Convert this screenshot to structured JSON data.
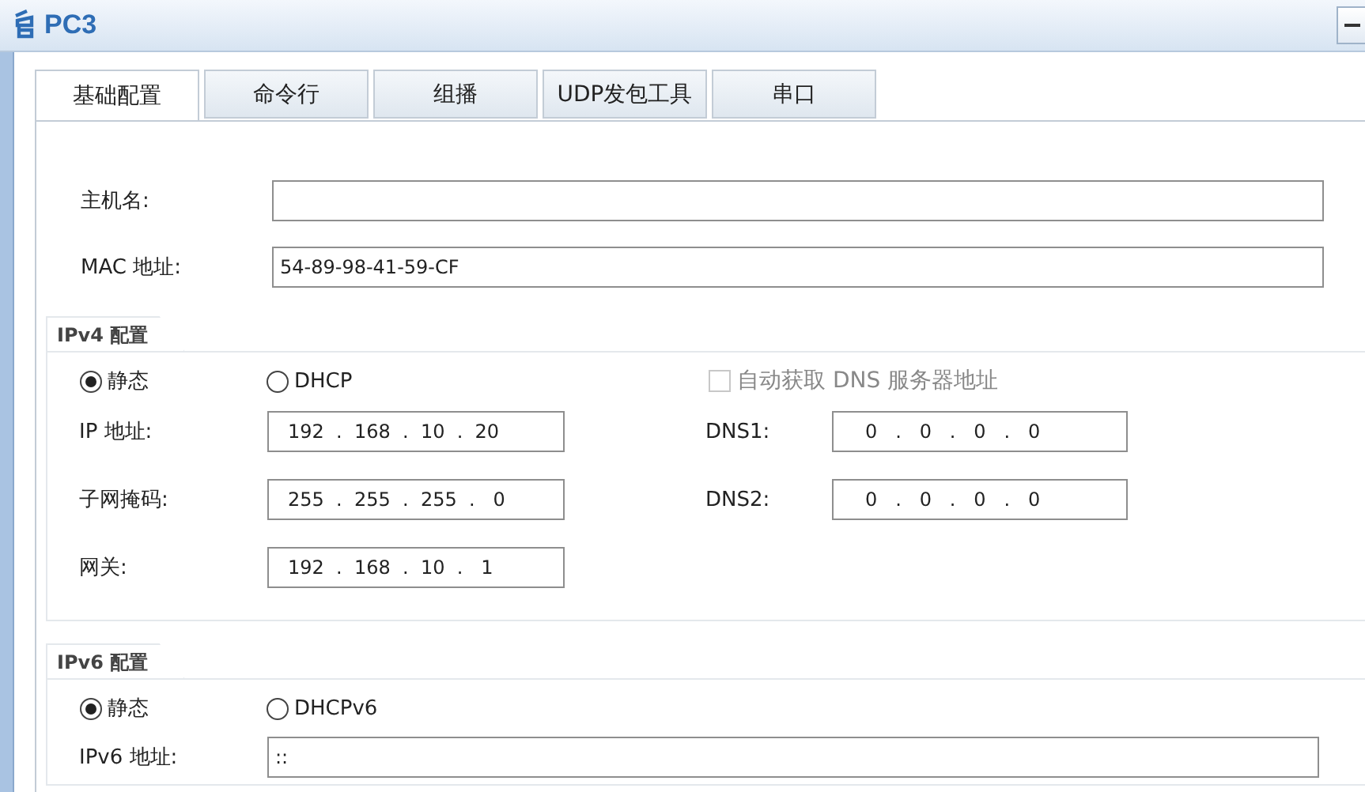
{
  "window": {
    "title": "PC3"
  },
  "tabs": [
    {
      "label": "基础配置",
      "selected": true
    },
    {
      "label": "命令行",
      "selected": false
    },
    {
      "label": "组播",
      "selected": false
    },
    {
      "label": "UDP发包工具",
      "selected": false
    },
    {
      "label": "串口",
      "selected": false
    }
  ],
  "host": {
    "label": "主机名:"
  },
  "mac": {
    "label": "MAC 地址:",
    "value": "54-89-98-41-59-CF"
  },
  "ipv4": {
    "title": "IPv4 配置",
    "modes": [
      {
        "label": "静态",
        "selected": true
      },
      {
        "label": "DHCP",
        "selected": false
      }
    ],
    "auto_dns": {
      "label": "自动获取 DNS 服务器地址",
      "checked": false,
      "disabled": true
    },
    "fields": [
      {
        "label": "IP 地址:",
        "value": "192  .  168  .  10  .  20"
      },
      {
        "label": "子网掩码:",
        "value": "255  .  255  .  255  .   0"
      },
      {
        "label": "网关:",
        "value": "192  .  168  .  10  .   1"
      }
    ],
    "dns": [
      {
        "label": "DNS1:",
        "value": "0   .   0   .   0   .   0"
      },
      {
        "label": "DNS2:",
        "value": "0   .   0   .   0   .   0"
      }
    ]
  },
  "ipv6": {
    "title": "IPv6 配置",
    "modes": [
      {
        "label": "静态",
        "selected": true
      },
      {
        "label": "DHCPv6",
        "selected": false
      }
    ],
    "address": {
      "label": "IPv6 地址:",
      "value": "::"
    }
  }
}
